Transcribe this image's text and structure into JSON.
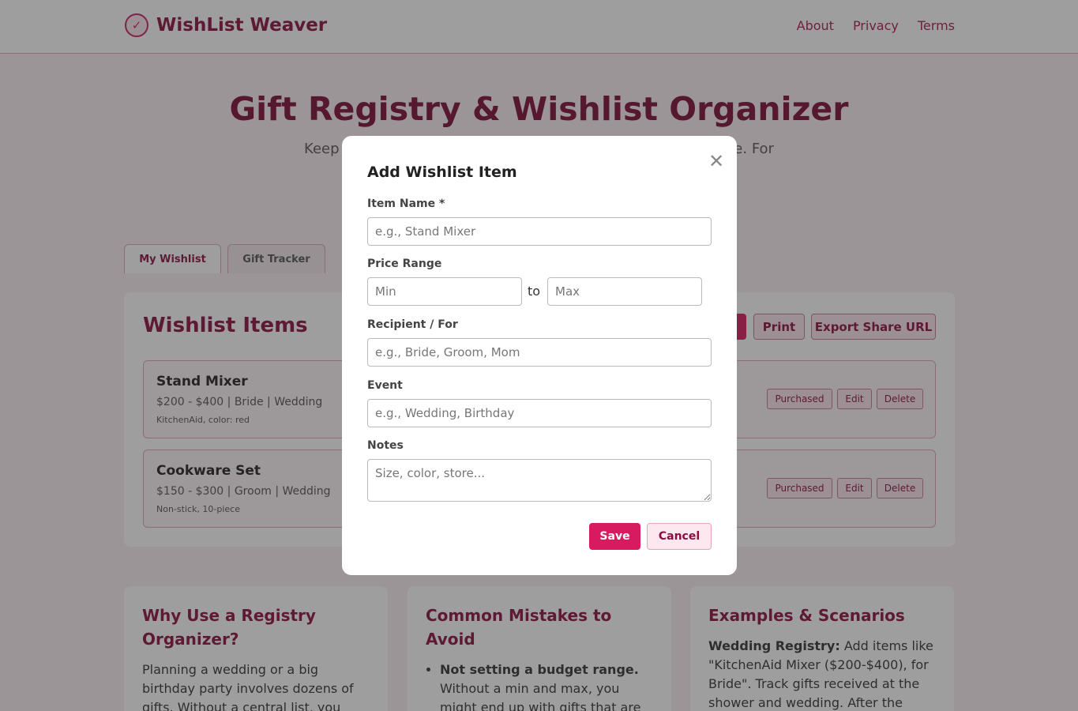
{
  "header": {
    "brand_icon": "check-circle-icon",
    "brand_name": "WishList Weaver",
    "nav": [
      "About",
      "Privacy",
      "Terms"
    ]
  },
  "hero": {
    "title": "Gift Registry & Wishlist Organizer",
    "subtitle": "Keep every                                                                    e place. For"
  },
  "tabs": [
    "My Wishlist",
    "Gift Tracker"
  ],
  "panel": {
    "title": "Wishlist Items",
    "buttons": {
      "print": "Print",
      "export": "Export Share URL"
    }
  },
  "items": [
    {
      "name": "Stand Mixer",
      "meta": "$200 - $400 | Bride | Wedding",
      "notes": "KitchenAid, color: red"
    },
    {
      "name": "Cookware Set",
      "meta": "$150 - $300 | Groom | Wedding",
      "notes": "Non-stick, 10-piece"
    }
  ],
  "item_actions": {
    "purchased": "Purchased",
    "edit": "Edit",
    "delete": "Delete"
  },
  "info": {
    "why": {
      "title": "Why Use a Registry Organizer?",
      "text": "Planning a wedding or a big birthday party involves dozens of gifts. Without a central list, you might"
    },
    "mistakes": {
      "title": "Common Mistakes to Avoid",
      "bullet_bold": "Not setting a budget range.",
      "bullet_text": " Without a min and max, you might end up with gifts that are too"
    },
    "examples": {
      "title": "Examples & Scenarios",
      "bold": "Wedding Registry:",
      "text": " Add items like \"KitchenAid Mixer ($200-$400), for Bride\". Track gifts received at the shower and wedding. After the event,"
    }
  },
  "modal": {
    "title": "Add Wishlist Item",
    "close_icon": "close-icon",
    "item_name_label": "Item Name *",
    "item_name_placeholder": "e.g., Stand Mixer",
    "price_label": "Price Range",
    "min_placeholder": "Min",
    "to_label": "to",
    "max_placeholder": "Max",
    "recipient_label": "Recipient / For",
    "recipient_placeholder": "e.g., Bride, Groom, Mom",
    "event_label": "Event",
    "event_placeholder": "e.g., Wedding, Birthday",
    "notes_label": "Notes",
    "notes_placeholder": "Size, color, store...",
    "save": "Save",
    "cancel": "Cancel"
  }
}
